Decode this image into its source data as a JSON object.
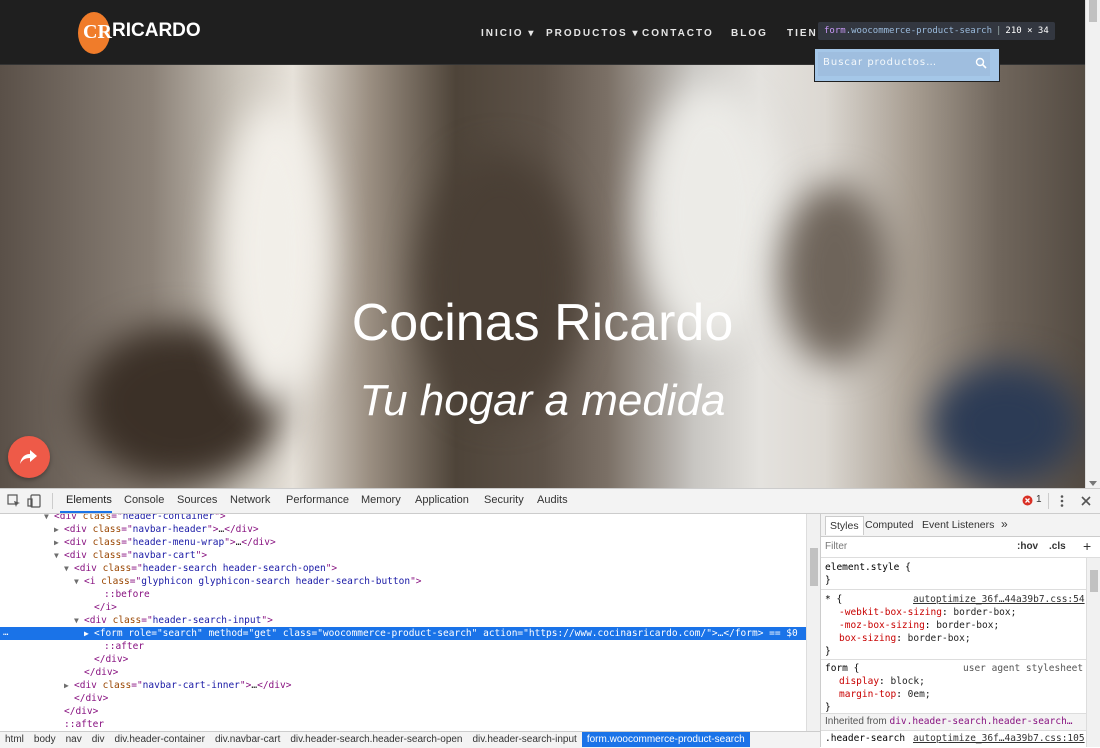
{
  "site": {
    "logo_letters": "CR",
    "logo_text": "RICARDO",
    "nav": [
      "INICIO",
      "PRODUCTOS",
      "CONTACTO",
      "BLOG",
      "TIENI"
    ],
    "hero_title": "Cocinas Ricardo",
    "hero_subtitle": "Tu hogar a medida",
    "search_placeholder": "Buscar productos…",
    "inspect_tag": "form",
    "inspect_class": ".woocommerce-product-search",
    "inspect_size": "210 × 34"
  },
  "devtools": {
    "tabs": [
      "Elements",
      "Console",
      "Sources",
      "Network",
      "Performance",
      "Memory",
      "Application",
      "Security",
      "Audits"
    ],
    "active_tab": "Elements",
    "error_count": "1",
    "dom_lines": [
      {
        "indent": 44,
        "twisty": "▼",
        "parts": [
          [
            "tg",
            "<div "
          ],
          [
            "an",
            "class"
          ],
          [
            "tg",
            "=\""
          ],
          [
            "av",
            "header-container"
          ],
          [
            "tg",
            "\">"
          ]
        ]
      },
      {
        "indent": 54,
        "twisty": "▶",
        "parts": [
          [
            "tg",
            "<div "
          ],
          [
            "an",
            "class"
          ],
          [
            "tg",
            "=\""
          ],
          [
            "av",
            "navbar-header"
          ],
          [
            "tg",
            "\">"
          ],
          [
            "tx",
            "…"
          ],
          [
            "tg",
            "</div>"
          ]
        ]
      },
      {
        "indent": 54,
        "twisty": "▶",
        "parts": [
          [
            "tg",
            "<div "
          ],
          [
            "an",
            "class"
          ],
          [
            "tg",
            "=\""
          ],
          [
            "av",
            "header-menu-wrap"
          ],
          [
            "tg",
            "\">"
          ],
          [
            "tx",
            "…"
          ],
          [
            "tg",
            "</div>"
          ]
        ]
      },
      {
        "indent": 54,
        "twisty": "▼",
        "parts": [
          [
            "tg",
            "<div "
          ],
          [
            "an",
            "class"
          ],
          [
            "tg",
            "=\""
          ],
          [
            "av",
            "navbar-cart"
          ],
          [
            "tg",
            "\">"
          ]
        ]
      },
      {
        "indent": 64,
        "twisty": "▼",
        "parts": [
          [
            "tg",
            "<div "
          ],
          [
            "an",
            "class"
          ],
          [
            "tg",
            "=\""
          ],
          [
            "av",
            "header-search header-search-open"
          ],
          [
            "tg",
            "\">"
          ]
        ]
      },
      {
        "indent": 74,
        "twisty": "▼",
        "parts": [
          [
            "tg",
            "<i "
          ],
          [
            "an",
            "class"
          ],
          [
            "tg",
            "=\""
          ],
          [
            "av",
            "glyphicon glyphicon-search header-search-button"
          ],
          [
            "tg",
            "\">"
          ]
        ]
      },
      {
        "indent": 94,
        "twisty": "",
        "parts": [
          [
            "ps",
            "::before"
          ]
        ]
      },
      {
        "indent": 84,
        "twisty": "",
        "parts": [
          [
            "tg",
            "</i>"
          ]
        ]
      },
      {
        "indent": 74,
        "twisty": "▼",
        "parts": [
          [
            "tg",
            "<div "
          ],
          [
            "an",
            "class"
          ],
          [
            "tg",
            "=\""
          ],
          [
            "av",
            "header-search-input"
          ],
          [
            "tg",
            "\">"
          ]
        ]
      },
      {
        "indent": 84,
        "twisty": "▶",
        "selected": true,
        "parts": [
          [
            "tg",
            "<form "
          ],
          [
            "an",
            "role"
          ],
          [
            "tg",
            "=\""
          ],
          [
            "av",
            "search"
          ],
          [
            "tg",
            "\" "
          ],
          [
            "an",
            "method"
          ],
          [
            "tg",
            "=\""
          ],
          [
            "av",
            "get"
          ],
          [
            "tg",
            "\" "
          ],
          [
            "an",
            "class"
          ],
          [
            "tg",
            "=\""
          ],
          [
            "av",
            "woocommerce-product-search"
          ],
          [
            "tg",
            "\" "
          ],
          [
            "an",
            "action"
          ],
          [
            "tg",
            "=\""
          ],
          [
            "av",
            "https://www.cocinasricardo.com/"
          ],
          [
            "tg",
            "\">"
          ],
          [
            "tx",
            "…"
          ],
          [
            "tg",
            "</form>"
          ],
          [
            "tx",
            " == $0"
          ]
        ]
      },
      {
        "indent": 94,
        "twisty": "",
        "parts": [
          [
            "ps",
            "::after"
          ]
        ]
      },
      {
        "indent": 84,
        "twisty": "",
        "parts": [
          [
            "tg",
            "</div>"
          ]
        ]
      },
      {
        "indent": 74,
        "twisty": "",
        "parts": [
          [
            "tg",
            "</div>"
          ]
        ]
      },
      {
        "indent": 64,
        "twisty": "▶",
        "parts": [
          [
            "tg",
            "<div "
          ],
          [
            "an",
            "class"
          ],
          [
            "tg",
            "=\""
          ],
          [
            "av",
            "navbar-cart-inner"
          ],
          [
            "tg",
            "\">"
          ],
          [
            "tx",
            "…"
          ],
          [
            "tg",
            "</div>"
          ]
        ]
      },
      {
        "indent": 64,
        "twisty": "",
        "parts": [
          [
            "tg",
            "</div>"
          ]
        ]
      },
      {
        "indent": 54,
        "twisty": "",
        "parts": [
          [
            "tg",
            "</div>"
          ]
        ]
      },
      {
        "indent": 54,
        "twisty": "",
        "parts": [
          [
            "ps",
            "::after"
          ]
        ]
      }
    ],
    "selected_marker": "…",
    "breadcrumbs": [
      "html",
      "body",
      "nav",
      "div",
      "div.header-container",
      "div.navbar-cart",
      "div.header-search.header-search-open",
      "div.header-search-input",
      "form.woocommerce-product-search"
    ],
    "styles": {
      "tabs": [
        "Styles",
        "Computed",
        "Event Listeners"
      ],
      "more": "»",
      "filter_label": "Filter",
      "hov": ":hov",
      "cls": ".cls",
      "plus": "+",
      "element_style": "element.style {",
      "close_brace": "}",
      "rule1_selector": "* {",
      "rule1_source": "autoptimize_36f…44a39b7.css:54",
      "rule1_props": [
        {
          "prop": "-webkit-box-sizing",
          "val": "border-box;",
          "struck": true
        },
        {
          "prop": "-moz-box-sizing",
          "val": "border-box;",
          "struck": true
        },
        {
          "prop": "box-sizing",
          "val": "border-box;",
          "struck": false
        }
      ],
      "rule2_selector": "form {",
      "rule2_source": "user agent stylesheet",
      "rule2_props": [
        {
          "prop": "display",
          "val": "block;"
        },
        {
          "prop": "margin-top",
          "val": "0em;"
        }
      ],
      "inherited_label": "Inherited from",
      "inherited_selector": "div.header-search.header-search…",
      "rule3_selector": ".header-search",
      "rule3_source": "autoptimize_36f…4a39b7.css:105"
    }
  }
}
